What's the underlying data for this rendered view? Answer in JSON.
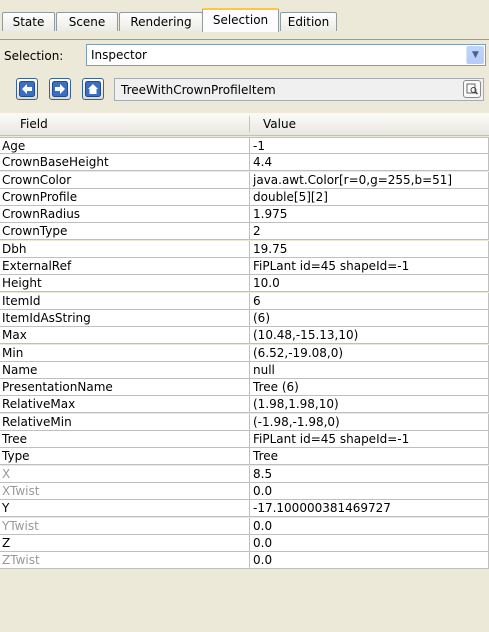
{
  "tabs": [
    {
      "label": "State"
    },
    {
      "label": "Scene"
    },
    {
      "label": "Rendering"
    },
    {
      "label": "Selection"
    },
    {
      "label": "Edition"
    }
  ],
  "selection": {
    "label": "Selection:",
    "value": "Inspector"
  },
  "nav": {
    "path": "TreeWithCrownProfileItem"
  },
  "table": {
    "headers": {
      "field": "Field",
      "value": "Value"
    },
    "rows": [
      {
        "field": "Age",
        "value": "-1"
      },
      {
        "field": "CrownBaseHeight",
        "value": "4.4"
      },
      {
        "field": "CrownColor",
        "value": "java.awt.Color[r=0,g=255,b=51]"
      },
      {
        "field": "CrownProfile",
        "value": "double[5][2]"
      },
      {
        "field": "CrownRadius",
        "value": "1.975"
      },
      {
        "field": "CrownType",
        "value": "2"
      },
      {
        "field": "Dbh",
        "value": "19.75"
      },
      {
        "field": "ExternalRef",
        "value": "FiPLant id=45 shapeId=-1"
      },
      {
        "field": "Height",
        "value": "10.0"
      },
      {
        "field": "ItemId",
        "value": "6"
      },
      {
        "field": "ItemIdAsString",
        "value": "(6)"
      },
      {
        "field": "Max",
        "value": "(10.48,-15.13,10)"
      },
      {
        "field": "Min",
        "value": "(6.52,-19.08,0)"
      },
      {
        "field": "Name",
        "value": "null"
      },
      {
        "field": "PresentationName",
        "value": "Tree (6)"
      },
      {
        "field": "RelativeMax",
        "value": "(1.98,1.98,10)"
      },
      {
        "field": "RelativeMin",
        "value": "(-1.98,-1.98,0)"
      },
      {
        "field": "Tree",
        "value": "FiPLant id=45 shapeId=-1"
      },
      {
        "field": "Type",
        "value": "Tree"
      },
      {
        "field": "X",
        "value": "8.5"
      },
      {
        "field": "XTwist",
        "value": "0.0"
      },
      {
        "field": "Y",
        "value": "-17.100000381469727"
      },
      {
        "field": "YTwist",
        "value": "0.0"
      },
      {
        "field": "Z",
        "value": "0.0"
      },
      {
        "field": "ZTwist",
        "value": "0.0"
      }
    ]
  },
  "colors": {
    "active_tab_accent": "#ffc83c",
    "nav_icon_blue": "#3a6fc4",
    "panel_bg": "#ece9d8"
  }
}
